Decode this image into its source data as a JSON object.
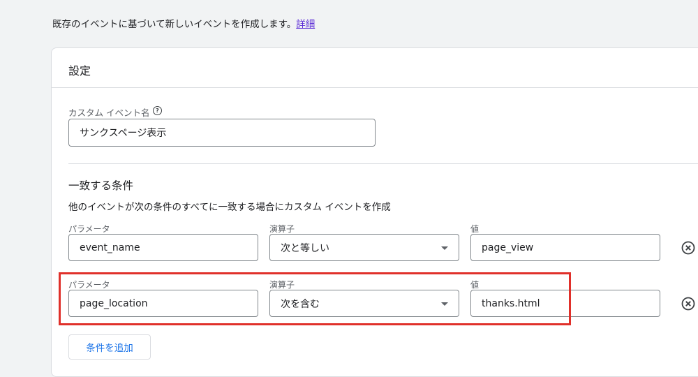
{
  "intro": {
    "text": "既存のイベントに基づいて新しいイベントを作成します。",
    "link": "詳細"
  },
  "card": {
    "title": "設定"
  },
  "custom_event": {
    "label": "カスタム イベント名",
    "value": "サンクスページ表示"
  },
  "conditions": {
    "title": "一致する条件",
    "description": "他のイベントが次の条件のすべてに一致する場合にカスタム イベントを作成",
    "rows": [
      {
        "param_label": "パラメータ",
        "param_value": "event_name",
        "op_label": "演算子",
        "op_value": "次と等しい",
        "val_label": "値",
        "val_value": "page_view"
      },
      {
        "param_label": "パラメータ",
        "param_value": "page_location",
        "op_label": "演算子",
        "op_value": "次を含む",
        "val_label": "値",
        "val_value": "thanks.html"
      }
    ],
    "add_button": "条件を追加"
  },
  "colors": {
    "highlight": "#e0302a",
    "accent": "#1a73e8",
    "link": "#5b2bd6"
  },
  "icons": {
    "help": "help-circle-icon",
    "remove": "remove-circle-icon"
  }
}
